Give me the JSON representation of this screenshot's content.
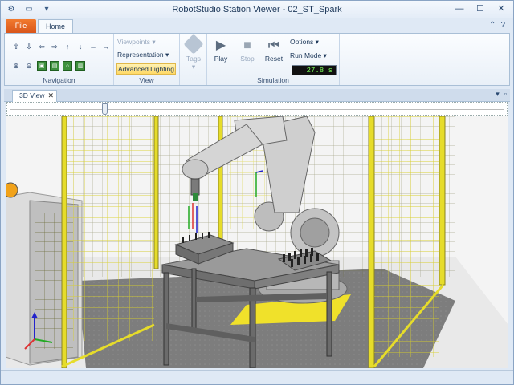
{
  "window": {
    "title": "RobotStudio Station Viewer - 02_ST_Spark",
    "controls": {
      "minimize": "—",
      "maximize": "☐",
      "close": "✕"
    }
  },
  "quick_access": {
    "icons": [
      "robot-icon",
      "open-folder-icon",
      "customize-dropdown-icon"
    ]
  },
  "tabs": {
    "file": "File",
    "home": "Home"
  },
  "ribbon": {
    "navigation": {
      "label": "Navigation"
    },
    "view": {
      "label": "View",
      "viewpoints": "Viewpoints ▾",
      "representation": "Representation ▾",
      "advanced_lighting": "Advanced Lighting"
    },
    "tags": {
      "label": "Tags"
    },
    "simulation": {
      "label": "Simulation",
      "play": "Play",
      "stop": "Stop",
      "reset": "Reset",
      "options": "Options ▾",
      "run_mode": "Run Mode ▾",
      "time": "27.8 s"
    }
  },
  "document": {
    "tab": "3D View"
  },
  "colors": {
    "file_tab": "#e4672a",
    "fence": "#e6dc2a",
    "robot": "#c9c9c9",
    "timer_text": "#7cff5a"
  }
}
